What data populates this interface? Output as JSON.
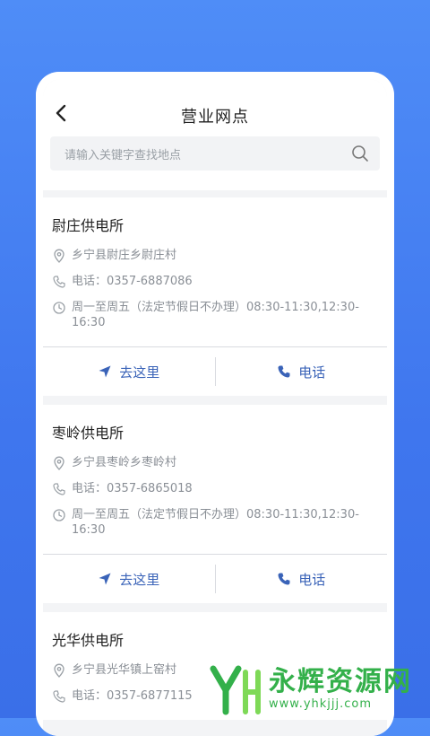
{
  "header": {
    "title": "营业网点"
  },
  "search": {
    "placeholder": "请输入关键字查找地点"
  },
  "offices": [
    {
      "name": "尉庄供电所",
      "address": "乡宁县尉庄乡尉庄村",
      "phone": "电话：0357-6887086",
      "hours": "周一至周五（法定节假日不办理）08:30-11:30,12:30-16:30",
      "go_label": "去这里",
      "call_label": "电话"
    },
    {
      "name": "枣岭供电所",
      "address": "乡宁县枣岭乡枣岭村",
      "phone": "电话：0357-6865018",
      "hours": "周一至周五（法定节假日不办理）08:30-11:30,12:30-16:30",
      "go_label": "去这里",
      "call_label": "电话"
    },
    {
      "name": "光华供电所",
      "address": "乡宁县光华镇上窑村",
      "phone": "电话：0357-6877115"
    }
  ],
  "watermark": {
    "text": "永辉资源网",
    "url": "www.yhkjjj.com"
  },
  "colors": {
    "accent": "#3a63b8",
    "background": "#4a86f4",
    "watermark": "#33b04a"
  }
}
